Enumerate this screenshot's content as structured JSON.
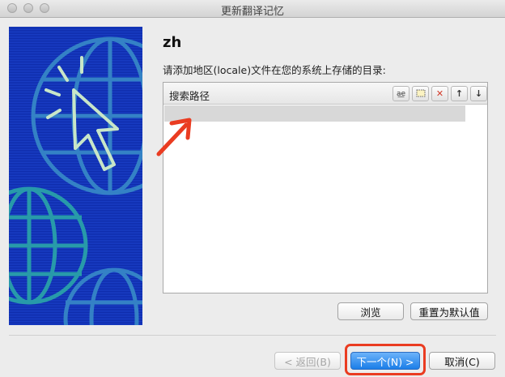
{
  "window": {
    "title": "更新翻译记忆"
  },
  "page": {
    "heading": "zh",
    "instruction": "请添加地区(locale)文件在您的系统上存储的目录:"
  },
  "list": {
    "column_header": "搜索路径",
    "rows": [
      ""
    ],
    "toolbar": [
      {
        "name": "spellcheck-icon",
        "glyph": "a͟e"
      },
      {
        "name": "new-folder-icon",
        "glyph": "▢"
      },
      {
        "name": "delete-icon",
        "glyph": "✕"
      },
      {
        "name": "move-up-icon",
        "glyph": "↑"
      },
      {
        "name": "move-down-icon",
        "glyph": "↓"
      }
    ]
  },
  "buttons": {
    "browse": "浏览",
    "reset_default": "重置为默认值",
    "back": "< 返回(B)",
    "next": "下一个(N) >",
    "cancel": "取消(C)"
  },
  "colors": {
    "accent": "#1b7ee8",
    "annotation": "#ea3c21",
    "side_image": "#1a3fc8"
  }
}
